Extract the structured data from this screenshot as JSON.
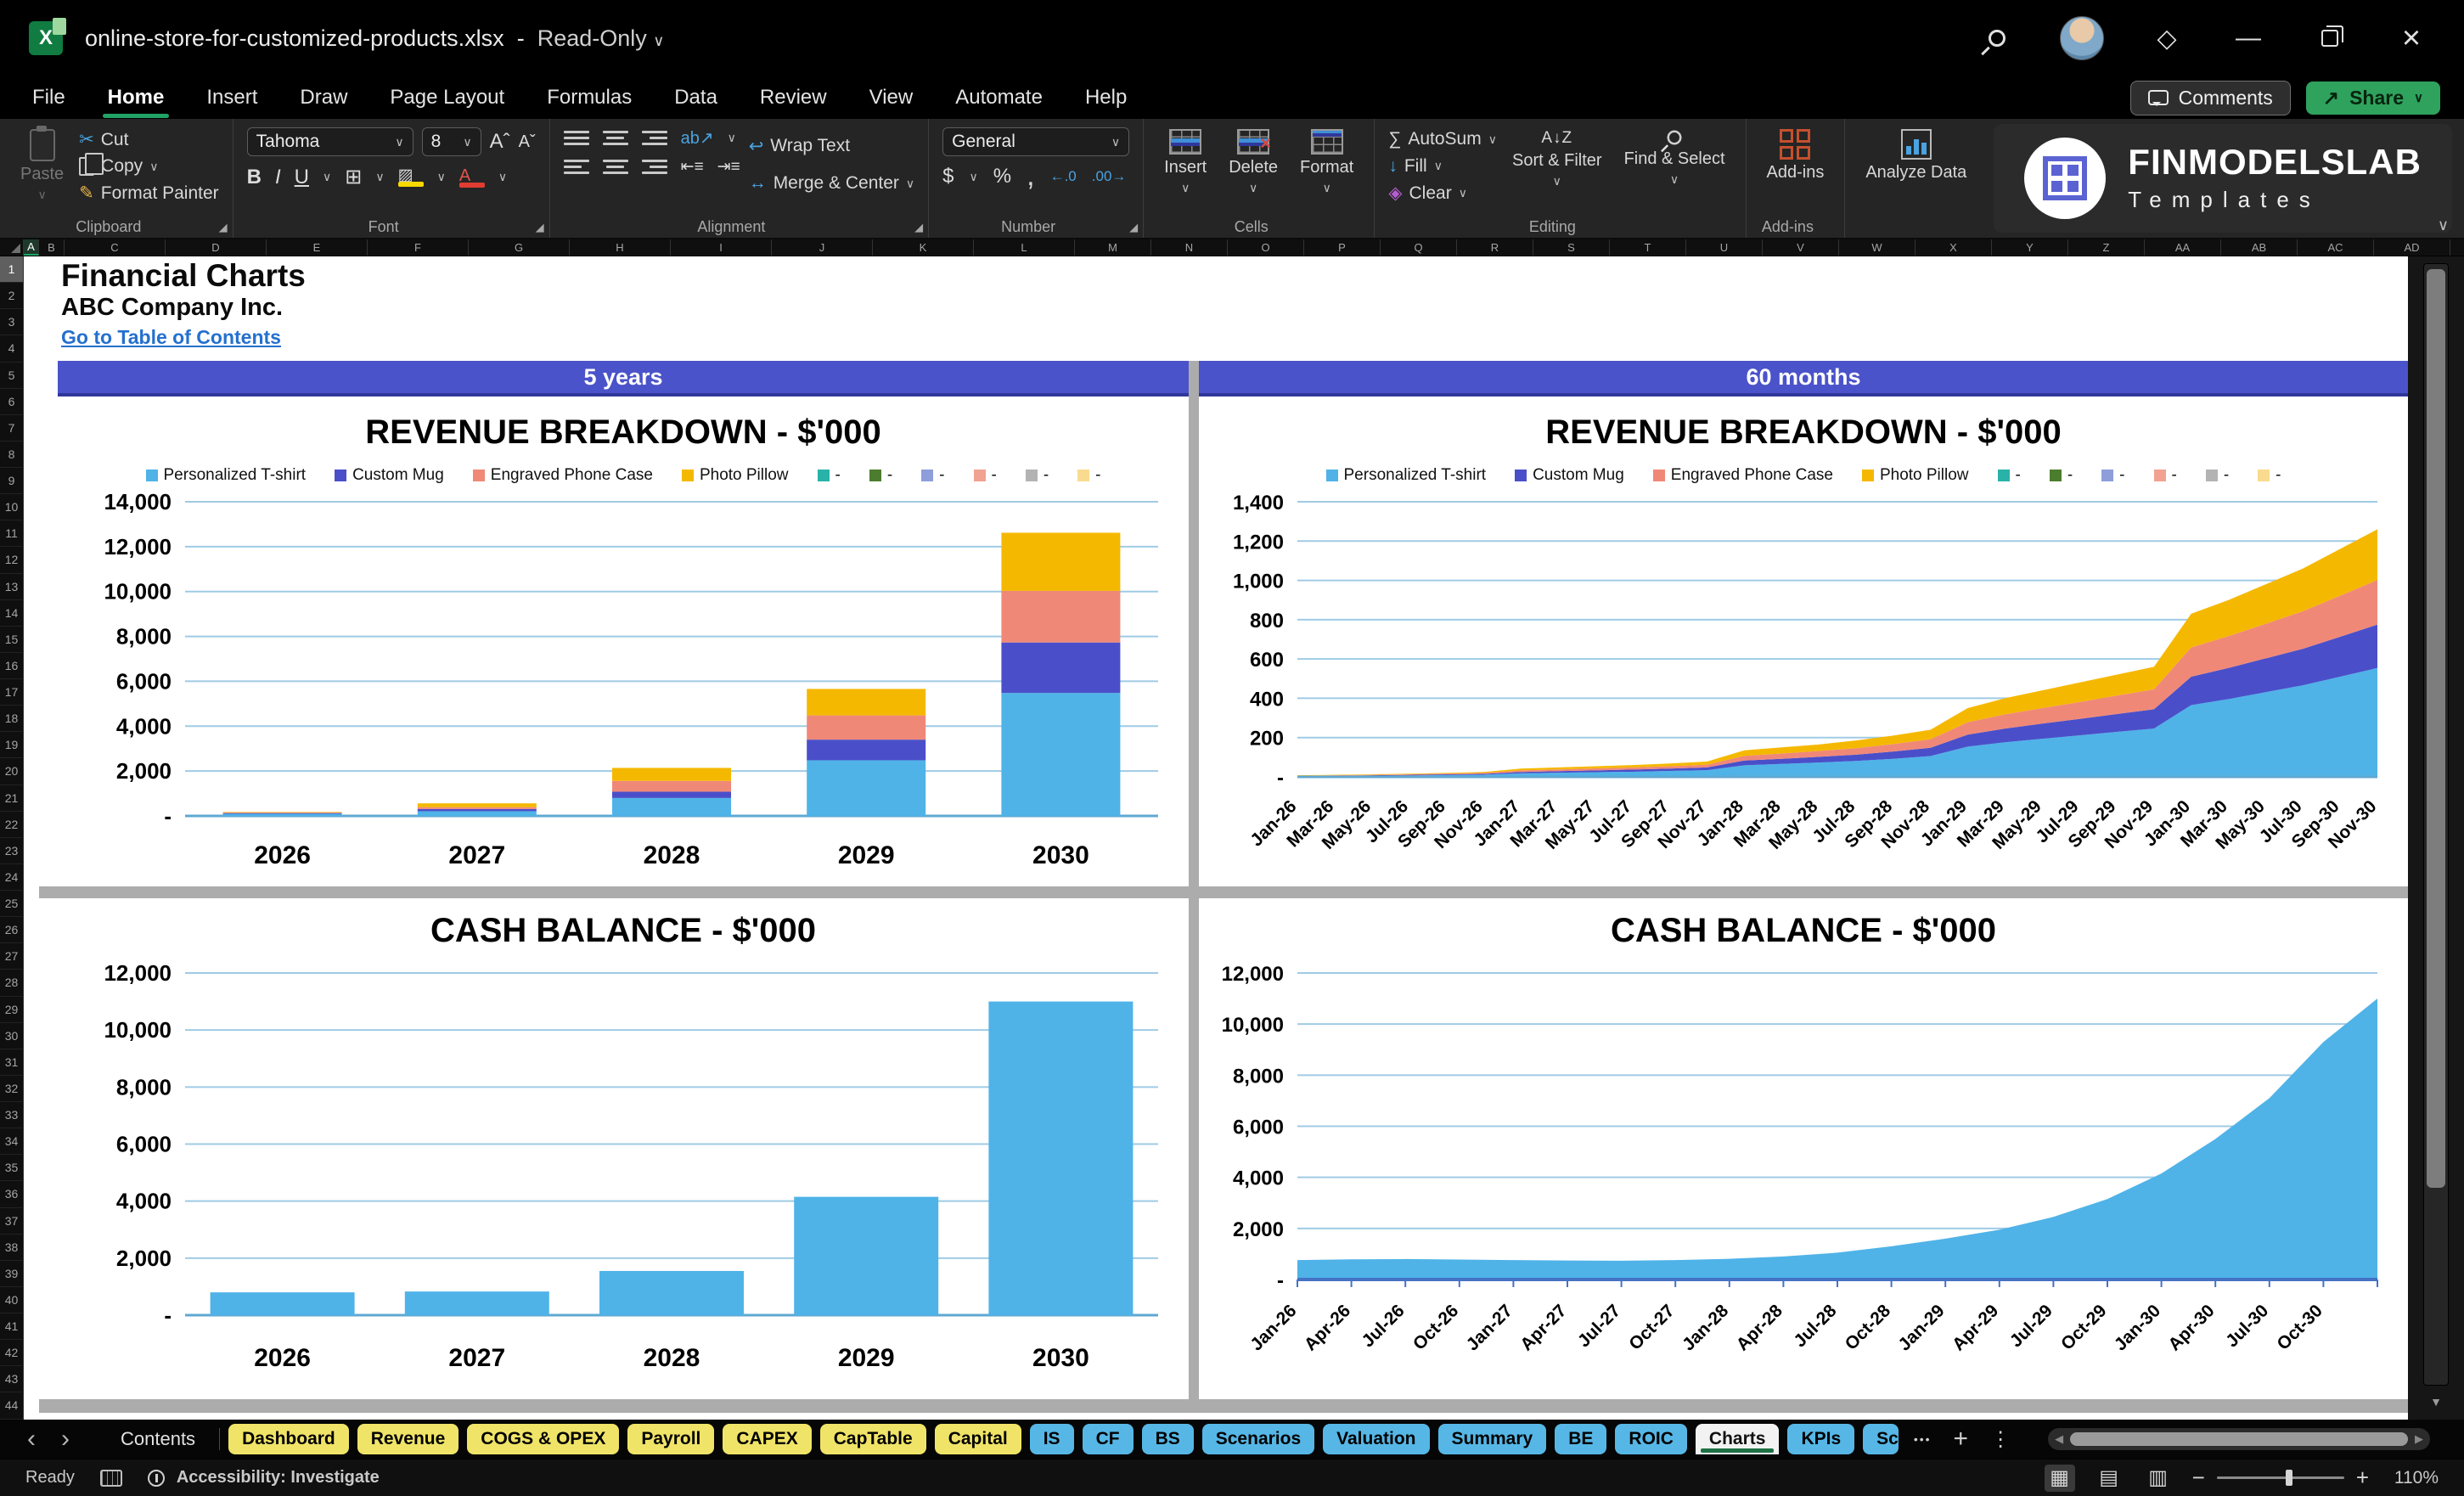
{
  "title_bar": {
    "file_name": "online-store-for-customized-products.xlsx",
    "separator": "-",
    "mode": "Read-Only"
  },
  "icons": {
    "chevron_down": "∨",
    "chevron_left": "‹",
    "chevron_right": "›",
    "minimize": "—",
    "close": "×",
    "diamond": "◇",
    "overflow": "•••",
    "plus": "+",
    "kebab": "⋮",
    "down_arrow": "▼",
    "left_arrow": "◀",
    "right_arrow": "▶",
    "launcher": "◢",
    "cut": "✂",
    "brush": "✎",
    "sum": "∑",
    "fill": "↓",
    "clear": "◈",
    "borders": "⊞",
    "grow_font": "Aˆ",
    "shrink_font": "Aˇ",
    "bold": "B",
    "italic": "I",
    "underline": "U",
    "dollar": "$",
    "percent": "%",
    "comma": ",",
    "dec_left": "←.0",
    "dec_right": ".00→",
    "orientation": "ab↗",
    "wrap": "↩",
    "merge": "↔",
    "sort_az": "A↓Z",
    "view_normal": "▦",
    "view_layout": "▤",
    "view_break": "▥"
  },
  "menu": {
    "items": [
      "File",
      "Home",
      "Insert",
      "Draw",
      "Page Layout",
      "Formulas",
      "Data",
      "Review",
      "View",
      "Automate",
      "Help"
    ],
    "active": "Home",
    "comments": "Comments",
    "share": "Share"
  },
  "ribbon": {
    "clipboard": {
      "label": "Clipboard",
      "paste": "Paste",
      "cut": "Cut",
      "copy": "Copy",
      "format_painter": "Format Painter"
    },
    "font": {
      "label": "Font",
      "font_name": "Tahoma",
      "font_size": "8"
    },
    "alignment": {
      "label": "Alignment",
      "wrap_text": "Wrap Text",
      "merge_center": "Merge & Center"
    },
    "number": {
      "label": "Number",
      "format": "General"
    },
    "cells": {
      "label": "Cells",
      "insert": "Insert",
      "delete": "Delete",
      "format": "Format"
    },
    "editing": {
      "label": "Editing",
      "autosum": "AutoSum",
      "fill": "Fill",
      "clear": "Clear",
      "sort_filter": "Sort & Filter",
      "find_select": "Find & Select"
    },
    "addins": {
      "label": "Add-ins",
      "addins": "Add-ins",
      "analyze": "Analyze Data"
    }
  },
  "brand": {
    "name": "FINMODELSLAB",
    "sub": "Templates"
  },
  "grid": {
    "columns": [
      "A",
      "B",
      "C",
      "D",
      "E",
      "F",
      "G",
      "H",
      "I",
      "J",
      "K",
      "L",
      "M",
      "N",
      "O",
      "P",
      "Q",
      "R",
      "S",
      "T",
      "U",
      "V",
      "W",
      "X",
      "Y",
      "Z",
      "AA",
      "AB",
      "AC",
      "AD"
    ],
    "active_column": "A",
    "row_first": 1,
    "row_last": 44,
    "active_row": 1
  },
  "sheet": {
    "title": "Financial Charts",
    "company": "ABC Company Inc.",
    "link": "Go to Table of Contents",
    "band_left": "5 years",
    "band_right": "60 months"
  },
  "colors": {
    "band": "#4A53C9",
    "hyperlink": "#2470CE",
    "tab_yellow": "#F0E468",
    "tab_blue": "#56B7E6",
    "active_tab_underline": "#1E7145",
    "gridline": "#9FCBE5",
    "axis": "#5FA8D3",
    "cash_axis": "#4472C4"
  },
  "chart_data": [
    {
      "id": "rev_5y",
      "type": "bar",
      "title": "REVENUE BREAKDOWN - $'000",
      "period": "5 years",
      "categories": [
        "2026",
        "2027",
        "2028",
        "2029",
        "2030"
      ],
      "series": [
        {
          "name": "Personalized T-shirt",
          "color": "#4FB3E8",
          "values": [
            95,
            210,
            800,
            2480,
            5480
          ]
        },
        {
          "name": "Custom Mug",
          "color": "#4A4FC9",
          "values": [
            30,
            95,
            280,
            920,
            2250
          ]
        },
        {
          "name": "Engraved Phone Case",
          "color": "#F08878",
          "values": [
            25,
            85,
            480,
            1080,
            2300
          ]
        },
        {
          "name": "Photo Pillow",
          "color": "#F5B800",
          "values": [
            25,
            170,
            580,
            1180,
            2590
          ]
        }
      ],
      "extra_legend": [
        {
          "label": "-",
          "color": "#29B2A8"
        },
        {
          "label": "-",
          "color": "#4C7D2F"
        },
        {
          "label": "-",
          "color": "#8E9EDB"
        },
        {
          "label": "-",
          "color": "#F2A291"
        },
        {
          "label": "-",
          "color": "#B3B3B3"
        },
        {
          "label": "-",
          "color": "#F8DB8F"
        }
      ],
      "ylim": [
        0,
        14000
      ],
      "ytick": 2000,
      "zero_label": "-",
      "grid": true,
      "legend_position": "top"
    },
    {
      "id": "rev_60m",
      "type": "area",
      "title": "REVENUE BREAKDOWN - $'000",
      "period": "60 months",
      "x": [
        "Jan-26",
        "Mar-26",
        "May-26",
        "Jul-26",
        "Sep-26",
        "Nov-26",
        "Jan-27",
        "Mar-27",
        "May-27",
        "Jul-27",
        "Sep-27",
        "Nov-27",
        "Jan-28",
        "Mar-28",
        "May-28",
        "Jul-28",
        "Sep-28",
        "Nov-28",
        "Jan-29",
        "Mar-29",
        "May-29",
        "Jul-29",
        "Sep-29",
        "Nov-29",
        "Jan-30",
        "Mar-30",
        "May-30",
        "Jul-30",
        "Sep-30",
        "Nov-30"
      ],
      "series": [
        {
          "name": "Personalized T-shirt",
          "color": "#4FB3E8",
          "values": [
            4,
            4,
            6,
            7,
            9,
            11,
            18,
            21,
            24,
            26,
            30,
            34,
            59,
            66,
            73,
            81,
            92,
            106,
            154,
            176,
            194,
            211,
            229,
            246,
            365,
            396,
            431,
            466,
            510,
            554
          ]
        },
        {
          "name": "Custom Mug",
          "color": "#4A4FC9",
          "values": [
            1,
            2,
            2,
            3,
            4,
            4,
            7,
            8,
            9,
            11,
            12,
            14,
            24,
            26,
            29,
            32,
            37,
            42,
            61,
            70,
            77,
            84,
            91,
            98,
            145,
            158,
            172,
            186,
            203,
            221
          ]
        },
        {
          "name": "Engraved Phone Case",
          "color": "#F08878",
          "values": [
            1,
            2,
            2,
            3,
            4,
            5,
            8,
            9,
            10,
            11,
            12,
            14,
            24,
            27,
            30,
            33,
            38,
            43,
            63,
            72,
            79,
            86,
            94,
            101,
            149,
            162,
            176,
            191,
            209,
            227
          ]
        },
        {
          "name": "Photo Pillow",
          "color": "#F5B800",
          "values": [
            2,
            2,
            3,
            3,
            3,
            5,
            9,
            10,
            11,
            12,
            14,
            16,
            28,
            31,
            33,
            39,
            43,
            49,
            72,
            82,
            90,
            99,
            106,
            115,
            171,
            184,
            201,
            217,
            238,
            258
          ]
        }
      ],
      "extra_legend": [
        {
          "label": "-",
          "color": "#29B2A8"
        },
        {
          "label": "-",
          "color": "#4C7D2F"
        },
        {
          "label": "-",
          "color": "#8E9EDB"
        },
        {
          "label": "-",
          "color": "#F2A291"
        },
        {
          "label": "-",
          "color": "#B3B3B3"
        },
        {
          "label": "-",
          "color": "#F8DB8F"
        }
      ],
      "ylim": [
        0,
        1400
      ],
      "ytick": 200,
      "zero_label": "-",
      "grid": true,
      "legend_position": "top"
    },
    {
      "id": "cash_5y",
      "type": "bar",
      "title": "CASH BALANCE - $'000",
      "period": "5 years",
      "categories": [
        "2026",
        "2027",
        "2028",
        "2029",
        "2030"
      ],
      "series": [
        {
          "name": "Cash balance",
          "color": "#4FB3E8",
          "values": [
            800,
            830,
            1550,
            4150,
            11000
          ]
        }
      ],
      "ylim": [
        0,
        12000
      ],
      "ytick": 2000,
      "zero_label": "-",
      "grid": true,
      "legend_position": "none"
    },
    {
      "id": "cash_60m",
      "type": "area",
      "title": "CASH BALANCE - $'000",
      "period": "60 months",
      "x": [
        "Jan-26",
        "Apr-26",
        "Jul-26",
        "Oct-26",
        "Jan-27",
        "Apr-27",
        "Jul-27",
        "Oct-27",
        "Jan-28",
        "Apr-28",
        "Jul-28",
        "Oct-28",
        "Jan-29",
        "Apr-29",
        "Jul-29",
        "Oct-29",
        "Jan-30",
        "Apr-30",
        "Jul-30",
        "Oct-30",
        ""
      ],
      "series": [
        {
          "name": "Cash balance",
          "color": "#4FB3E8",
          "values": [
            760,
            790,
            800,
            780,
            760,
            745,
            735,
            760,
            810,
            900,
            1050,
            1300,
            1600,
            1950,
            2450,
            3150,
            4150,
            5500,
            7100,
            9300,
            11000
          ]
        }
      ],
      "ylim": [
        0,
        12000
      ],
      "ytick": 2000,
      "zero_label": "-",
      "grid": true,
      "axis_ticks": true,
      "legend_position": "none"
    }
  ],
  "tabs": {
    "contents": "Contents",
    "sheets": [
      {
        "label": "Dashboard",
        "color": "yellow"
      },
      {
        "label": "Revenue",
        "color": "yellow"
      },
      {
        "label": "COGS & OPEX",
        "color": "yellow"
      },
      {
        "label": "Payroll",
        "color": "yellow"
      },
      {
        "label": "CAPEX",
        "color": "yellow"
      },
      {
        "label": "CapTable",
        "color": "yellow"
      },
      {
        "label": "Capital",
        "color": "yellow"
      },
      {
        "label": "IS",
        "color": "blue"
      },
      {
        "label": "CF",
        "color": "blue"
      },
      {
        "label": "BS",
        "color": "blue"
      },
      {
        "label": "Scenarios",
        "color": "blue"
      },
      {
        "label": "Valuation",
        "color": "blue"
      },
      {
        "label": "Summary",
        "color": "blue"
      },
      {
        "label": "BE",
        "color": "blue"
      },
      {
        "label": "ROIC",
        "color": "blue"
      },
      {
        "label": "Charts",
        "color": "active"
      },
      {
        "label": "KPIs",
        "color": "blue"
      },
      {
        "label": "Sc",
        "color": "blue",
        "clipped": true
      }
    ],
    "active": "Charts"
  },
  "status": {
    "ready": "Ready",
    "accessibility": "Accessibility: Investigate",
    "zoom": "110%"
  }
}
